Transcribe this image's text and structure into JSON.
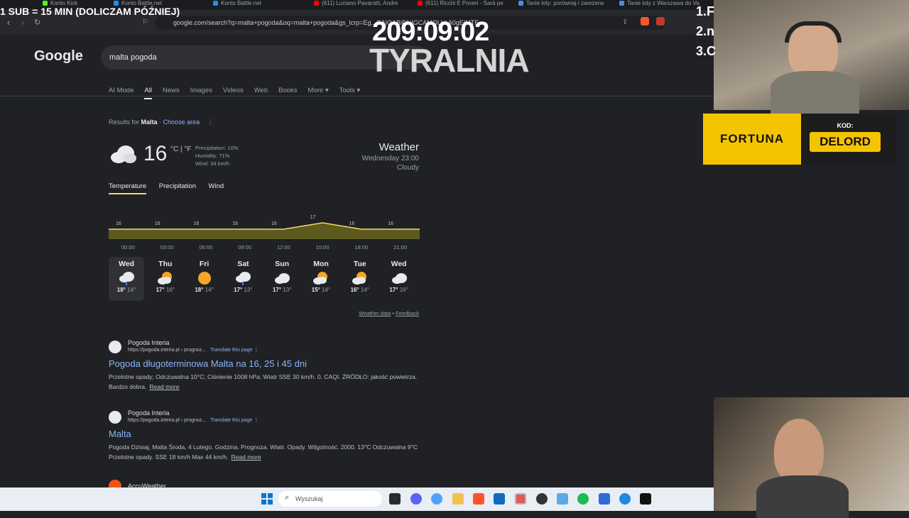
{
  "browser": {
    "tabs": [
      {
        "label": "Konto Kick",
        "left": 60,
        "color": "#53fc18"
      },
      {
        "label": "Konto Battle.net",
        "left": 160,
        "color": "#1e90ff"
      },
      {
        "label": "Konto Battle.net",
        "left": 300,
        "color": "#1e90ff"
      },
      {
        "label": "(611) Luciano Pavarotti, Andre",
        "left": 442,
        "color": "#ff0000"
      },
      {
        "label": "(611) Ricchi E Poveri - Sarà pe",
        "left": 588,
        "color": "#ff0000"
      },
      {
        "label": "Tanie loty: porównaj i zarezerw",
        "left": 730,
        "color": "#4a90e2"
      },
      {
        "label": "Tanie loty z Warszawa do Va",
        "left": 872,
        "color": "#4a90e2"
      }
    ],
    "url": "google.com/search?q=malta+pogoda&oq=malta+pogoda&gs_lcrp=Eg...CAIQABiPAjIGCAMQLhhA0gEIMTE..."
  },
  "overlay": {
    "sub_text": "1 SUB = 15 MIN (DOLICZAM PÓŹNIEJ)",
    "timer": "209:09:02",
    "brand": "TYRALNIA",
    "ranks": [
      "1.F",
      "2.n",
      "3.C"
    ]
  },
  "google": {
    "logo": "Google",
    "query": "malta pogoda",
    "tabs": [
      "AI Mode",
      "All",
      "News",
      "Images",
      "Videos",
      "Web",
      "Books",
      "More ▾",
      "Tools ▾"
    ],
    "active_tab": "All"
  },
  "weather": {
    "results_for_prefix": "Results for",
    "location": "Malta",
    "choose_area": "Choose area",
    "temperature": "16",
    "units": "°C | °F",
    "precipitation": "Precipitation: 10%",
    "humidity": "Humidity: 71%",
    "wind": "Wind: 34 km/h",
    "title": "Weather",
    "date": "Wednesday 23:00",
    "condition": "Cloudy",
    "tabs": [
      "Temperature",
      "Precipitation",
      "Wind"
    ],
    "weather_data_link": "Weather data",
    "feedback_link": "Feedback"
  },
  "chart_data": {
    "type": "area",
    "x": [
      "00:00",
      "03:00",
      "06:00",
      "09:00",
      "12:00",
      "15:00",
      "18:00",
      "21:00"
    ],
    "values": [
      16,
      16,
      16,
      16,
      16,
      17,
      16,
      16
    ],
    "ylim": [
      14,
      18
    ],
    "fill_color": "#5c5a1e",
    "line_color": "#fdd663"
  },
  "forecast": [
    {
      "day": "Wed",
      "icon": "cloud-rain-icon",
      "high": "18°",
      "low": "14°",
      "selected": true
    },
    {
      "day": "Thu",
      "icon": "partly-cloudy-icon",
      "high": "17°",
      "low": "16°"
    },
    {
      "day": "Fri",
      "icon": "sun-icon",
      "high": "18°",
      "low": "14°"
    },
    {
      "day": "Sat",
      "icon": "cloud-rain-icon",
      "high": "17°",
      "low": "13°"
    },
    {
      "day": "Sun",
      "icon": "cloud-icon",
      "high": "17°",
      "low": "13°"
    },
    {
      "day": "Mon",
      "icon": "partly-cloudy-icon",
      "high": "15°",
      "low": "14°"
    },
    {
      "day": "Tue",
      "icon": "partly-cloudy-icon",
      "high": "16°",
      "low": "14°"
    },
    {
      "day": "Wed",
      "icon": "cloud-icon",
      "high": "17°",
      "low": "16°"
    }
  ],
  "results": [
    {
      "site": "Pogoda Interia",
      "url": "https://pogoda.interia.pl › prognoz...",
      "translate": "Translate this page",
      "title": "Pogoda długoterminowa Malta na 16, 25 i 45 dni",
      "snippet": "Przelotne opady; Odczuwalna 10°C; Ciśnienie 1008 hPa; Wiatr SSE 30 km/h. 0. CAQI. ŹRÓDŁO: jakość powietrza. Bardzo dobra.",
      "more": "Read more"
    },
    {
      "site": "Pogoda Interia",
      "url": "https://pogoda.interia.pl › prognoz...",
      "translate": "Translate this page",
      "title": "Malta",
      "snippet": "Pogoda Dzisiaj, Malta Środa, 4 Lutego. Godzina. Prognoza. Wiatr. Opady. Wilgotność. 2000. 13°C Odczuwalna 9°C Przelotne opady. SSE 18 km/h Max 44 km/h.",
      "more": "Read more"
    },
    {
      "site": "AccuWeather"
    }
  ],
  "ad": {
    "brand": "FORTUNA",
    "code_label": "KOD:",
    "code": "DELORD"
  },
  "taskbar": {
    "search_placeholder": "Wyszukaj"
  }
}
